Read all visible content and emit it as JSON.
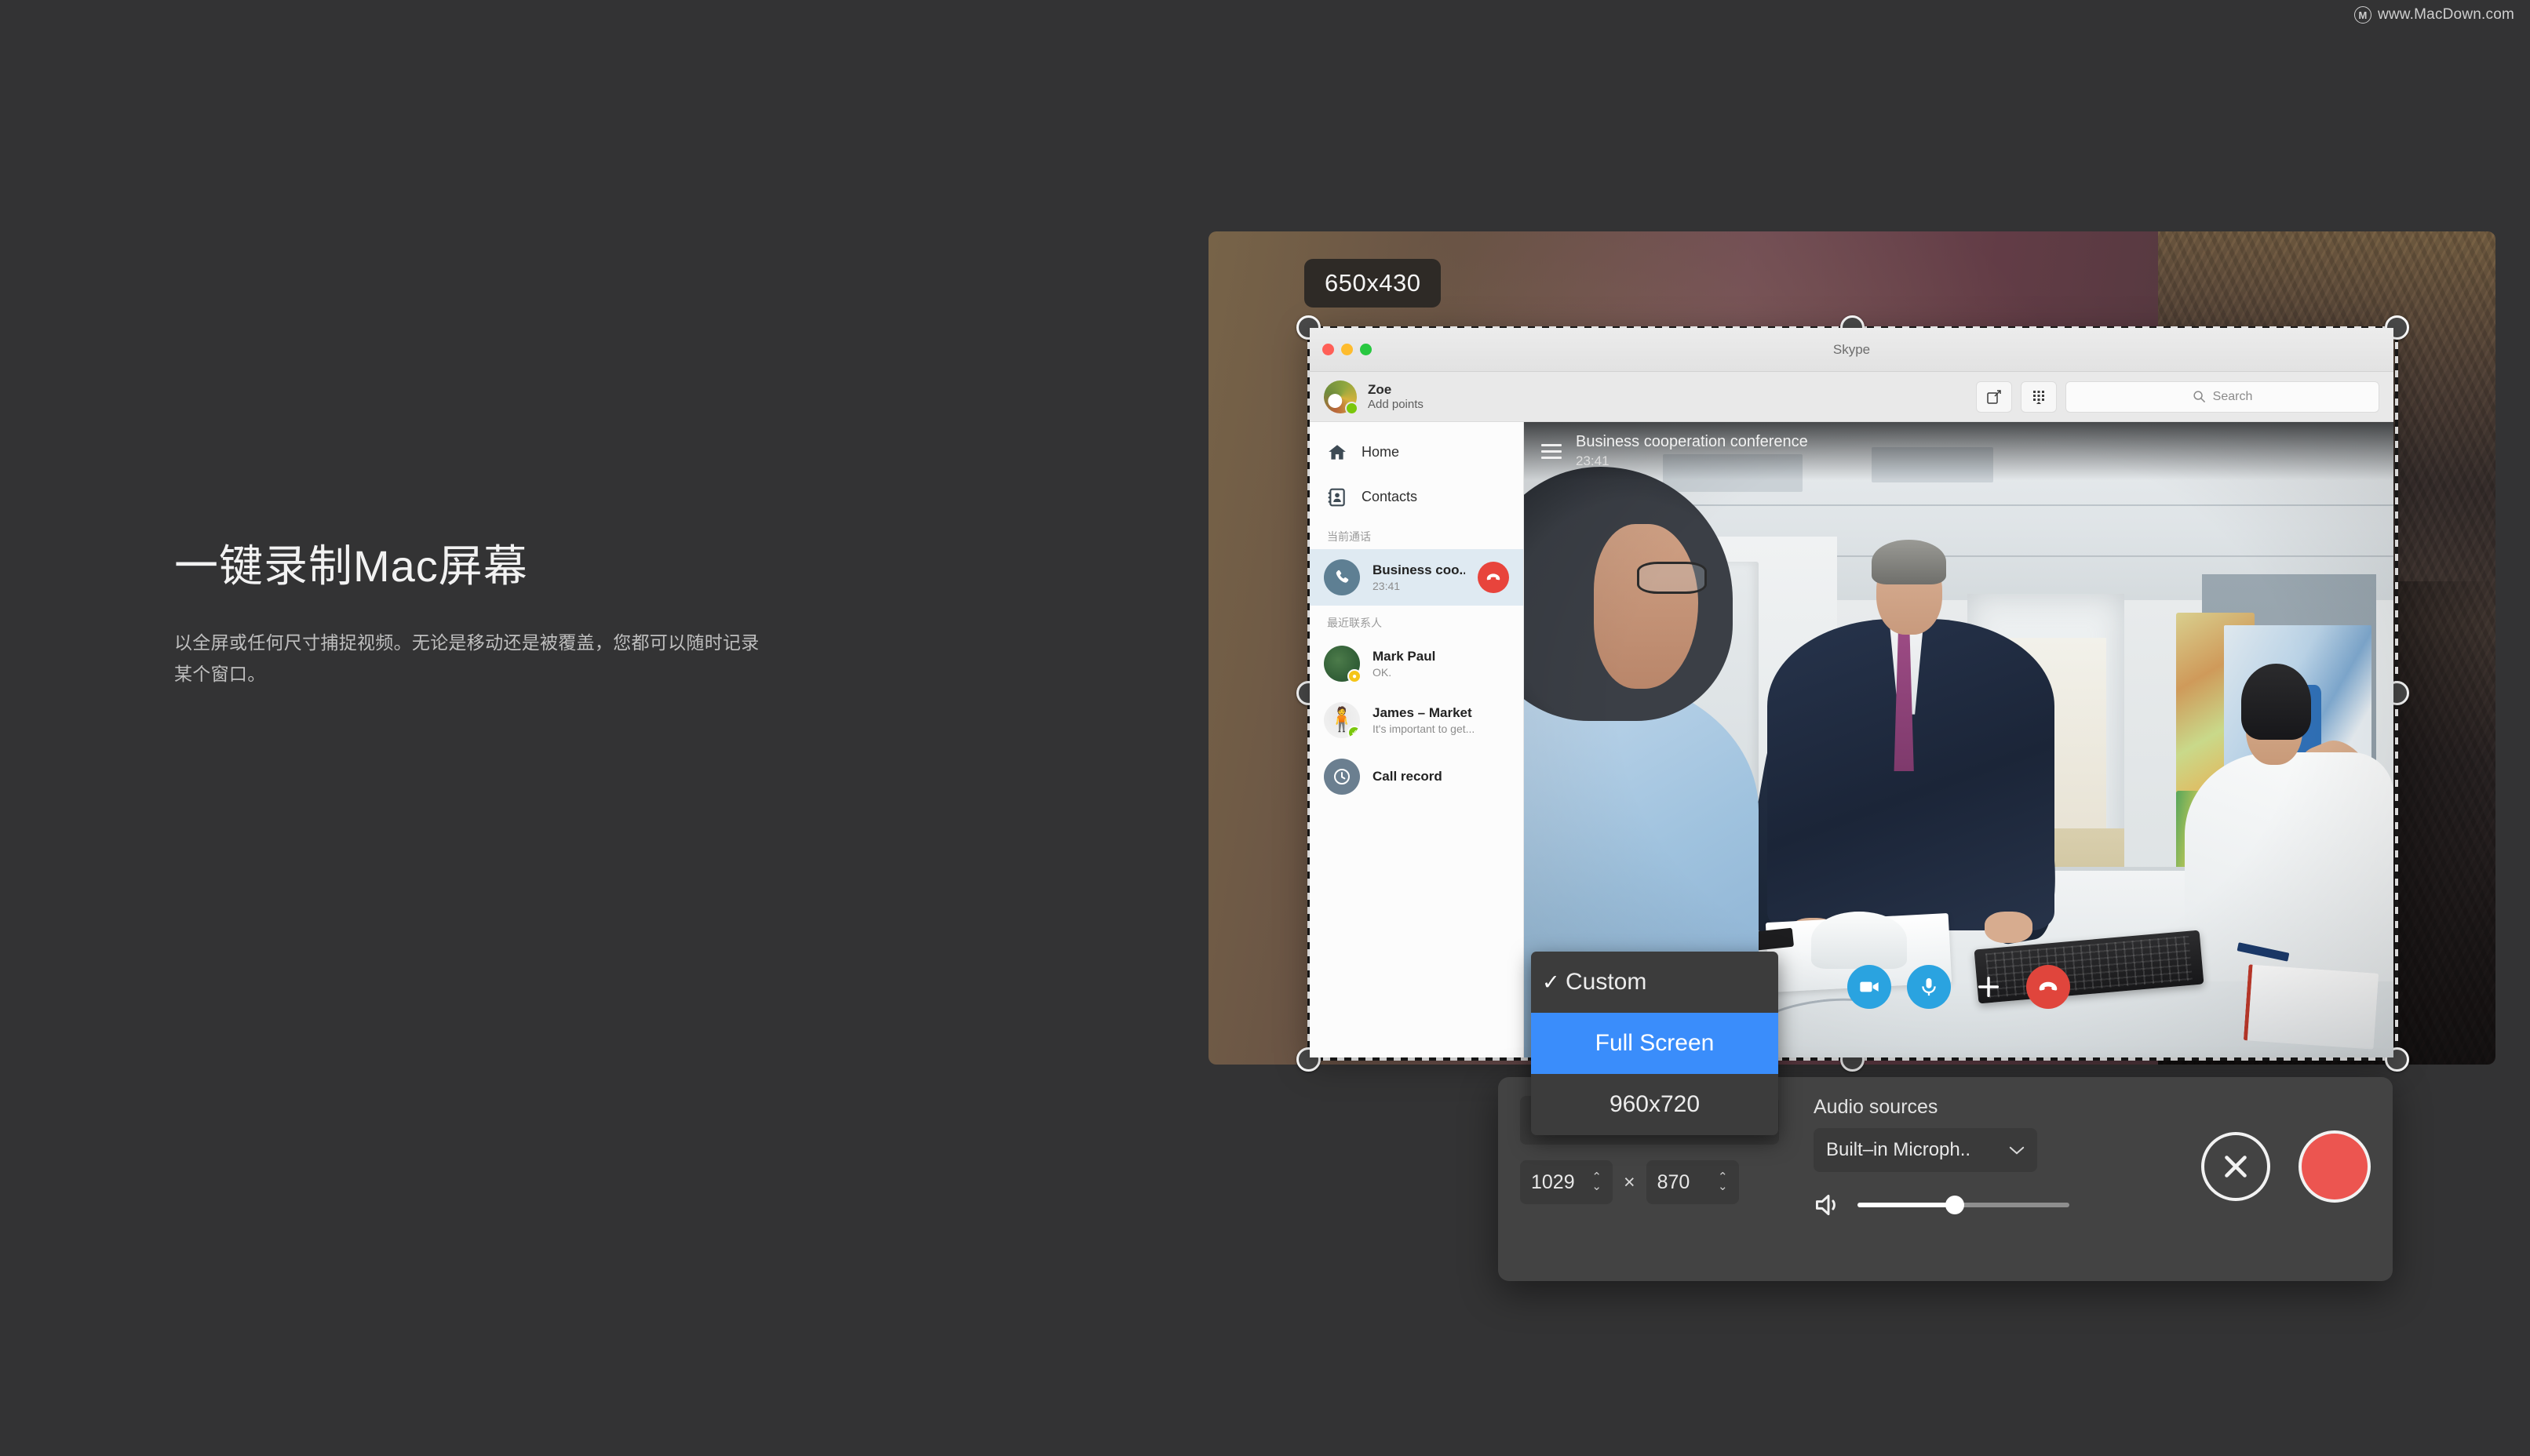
{
  "watermark": {
    "logo_letter": "M",
    "text": "www.MacDown.com"
  },
  "copy": {
    "headline": "一键录制Mac屏幕",
    "subcopy": "以全屏或任何尺寸捕捉视频。无论是移动还是被覆盖，您都可以随时记录某个窗口。"
  },
  "capture": {
    "size_badge": "650x430"
  },
  "skype": {
    "app_name": "Skype",
    "profile": {
      "name": "Zoe",
      "status": "Add points"
    },
    "search_placeholder": "Search",
    "nav": [
      {
        "icon": "home-icon",
        "label": "Home"
      },
      {
        "icon": "contacts-icon",
        "label": "Contacts"
      }
    ],
    "section_current": "当前通话",
    "section_recent": "最近联系人",
    "current_call": {
      "title": "Business coo..",
      "time": "23:41"
    },
    "recent": [
      {
        "name": "Mark Paul",
        "preview": "OK."
      },
      {
        "name": "James – Market",
        "preview": "It's important to get..."
      }
    ],
    "call_record_label": "Call record",
    "video": {
      "title": "Business cooperation conference",
      "duration": "23:41",
      "controls": [
        "video-camera-icon",
        "microphone-icon",
        "add-person-icon",
        "end-call-icon"
      ]
    }
  },
  "recorder": {
    "preset_value": "Custom",
    "width_value": "1029",
    "height_value": "870",
    "dim_separator": "×",
    "audio_label": "Audio sources",
    "audio_value": "Built–in Microph..",
    "cancel_label": "×",
    "record_label": ""
  },
  "preset_menu": {
    "items": [
      {
        "label": "Custom",
        "checked": true,
        "selected": false
      },
      {
        "label": "Full Screen",
        "checked": false,
        "selected": true
      },
      {
        "label": "960x720",
        "checked": false,
        "selected": false
      }
    ],
    "check_glyph": "✓"
  },
  "colors": {
    "page_bg": "#333334",
    "accent_blue": "#3a8dfb",
    "record_red": "#ec5550",
    "skype_blue": "#2aa3e0"
  }
}
